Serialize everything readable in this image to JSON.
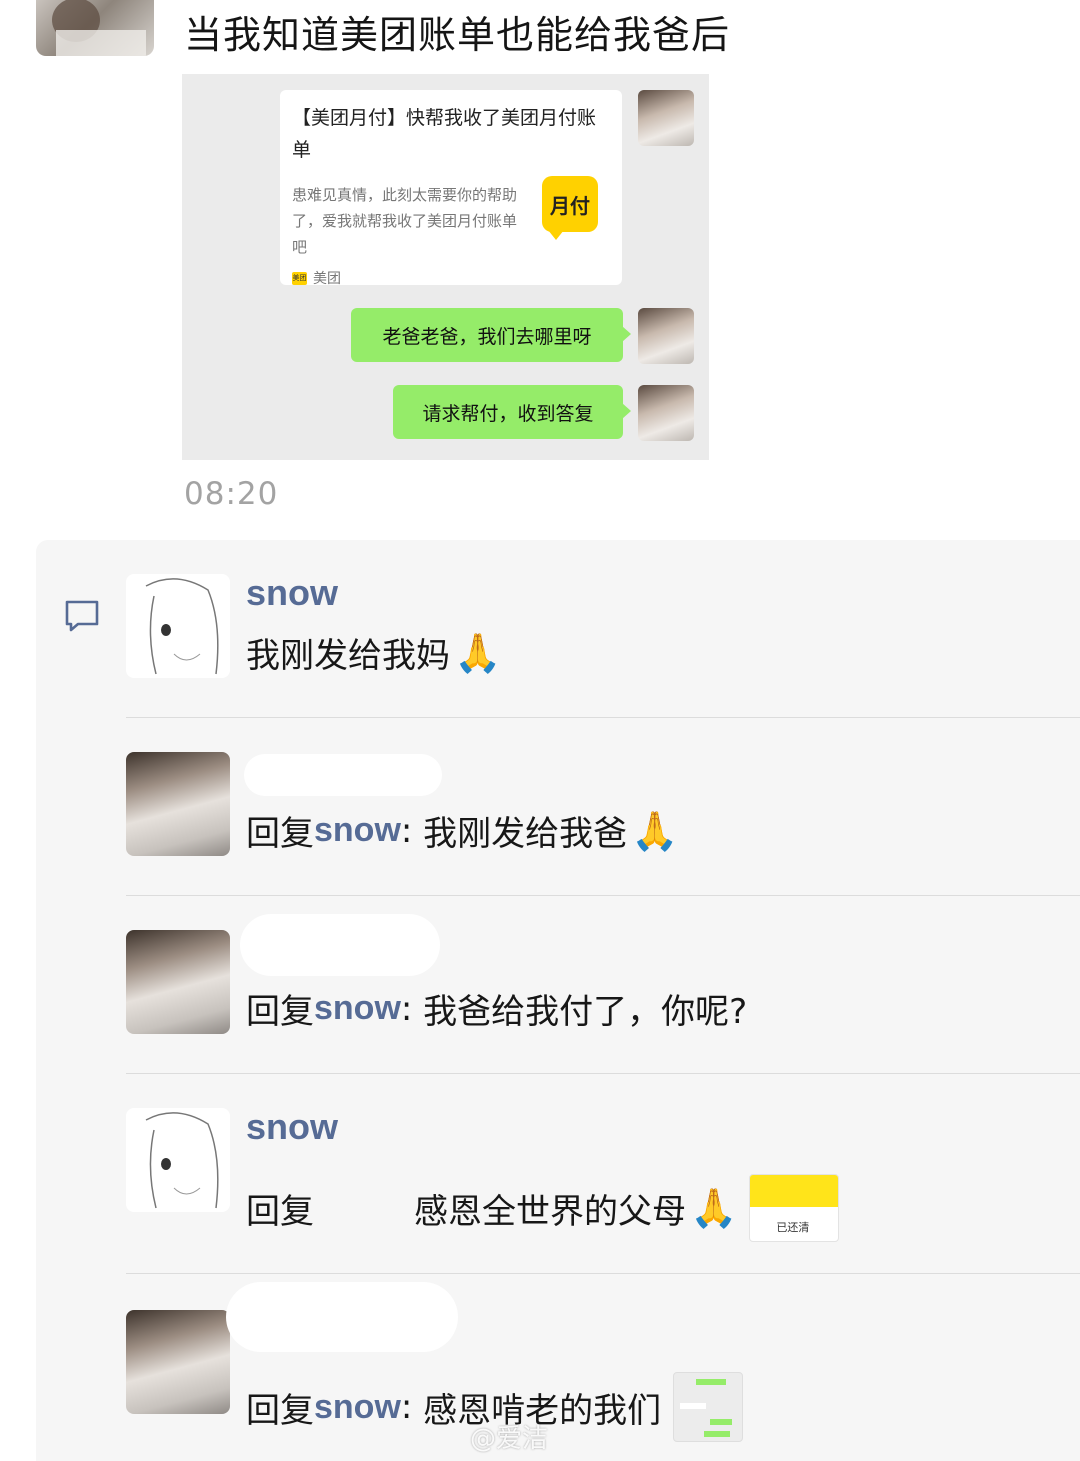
{
  "post": {
    "title": "当我知道美团账单也能给我爸后",
    "time": "08:20",
    "screenshot": {
      "card": {
        "title": "【美团月付】快帮我收了美团月付账单",
        "desc": "患难见真情，此刻太需要你的帮助了，爱我就帮我收了美团月付账单吧",
        "badge": "月付",
        "source_logo": "美团",
        "source": "美团"
      },
      "bubbles": [
        "老爸老爸，我们去哪里呀",
        "请求帮付，收到答复"
      ]
    }
  },
  "comments": [
    {
      "name": "snow",
      "prefix": "",
      "reply_to": "",
      "sep": "",
      "text": "我刚发给我妈",
      "emoji": "🙏",
      "avatar": "anime"
    },
    {
      "name": "",
      "prefix": "回复",
      "reply_to": "snow",
      "sep": ": ",
      "text": "我刚发给我爸",
      "emoji": "🙏",
      "avatar": "photo"
    },
    {
      "name": "",
      "prefix": "回复",
      "reply_to": "snow",
      "sep": ": ",
      "text": "我爸给我付了，你呢?",
      "emoji": "",
      "avatar": "photo"
    },
    {
      "name": "snow",
      "prefix": "回复",
      "reply_to": "",
      "sep": "",
      "text": "感恩全世界的父母",
      "emoji": "🙏",
      "avatar": "anime",
      "thumb_label": "已还清"
    },
    {
      "name": "",
      "prefix": "回复",
      "reply_to": "snow",
      "sep": ": ",
      "text": "感恩啃老的我们",
      "emoji": "",
      "avatar": "photo"
    }
  ],
  "watermark": "@爱洁",
  "colors": {
    "accent_name": "#566b95",
    "bubble_green": "#95ec69",
    "meituan_yellow": "#ffd100"
  }
}
